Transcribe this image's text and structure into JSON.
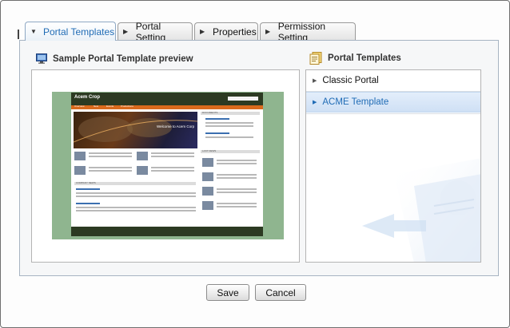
{
  "tabs": [
    {
      "label": "Portal Templates",
      "active": true
    },
    {
      "label": "Portal Setting",
      "active": false
    },
    {
      "label": "Properties",
      "active": false
    },
    {
      "label": "Permission Setting",
      "active": false
    }
  ],
  "preview": {
    "title": "Sample Portal Template preview",
    "icon": "monitor-icon",
    "thumbnail": {
      "site_name": "Acem Crop",
      "banner_text": "Welcome to Acem Corp",
      "nav_items": [
        "Overview",
        "New",
        "Events",
        "Productions"
      ],
      "documents_heading": "DOCUMENTS",
      "last_news_heading": "LAST NEWS",
      "company_news_heading": "COMPANY NEWS"
    }
  },
  "templates": {
    "title": "Portal Templates",
    "icon": "template-list-icon",
    "items": [
      {
        "label": "Classic Portal",
        "selected": false
      },
      {
        "label": "ACME Template",
        "selected": true
      }
    ]
  },
  "actions": {
    "save_label": "Save",
    "cancel_label": "Cancel"
  },
  "colors": {
    "accent": "#1f6bb5",
    "selection_bg": "#d8e6f7",
    "panel_border": "#a7b4c2"
  }
}
